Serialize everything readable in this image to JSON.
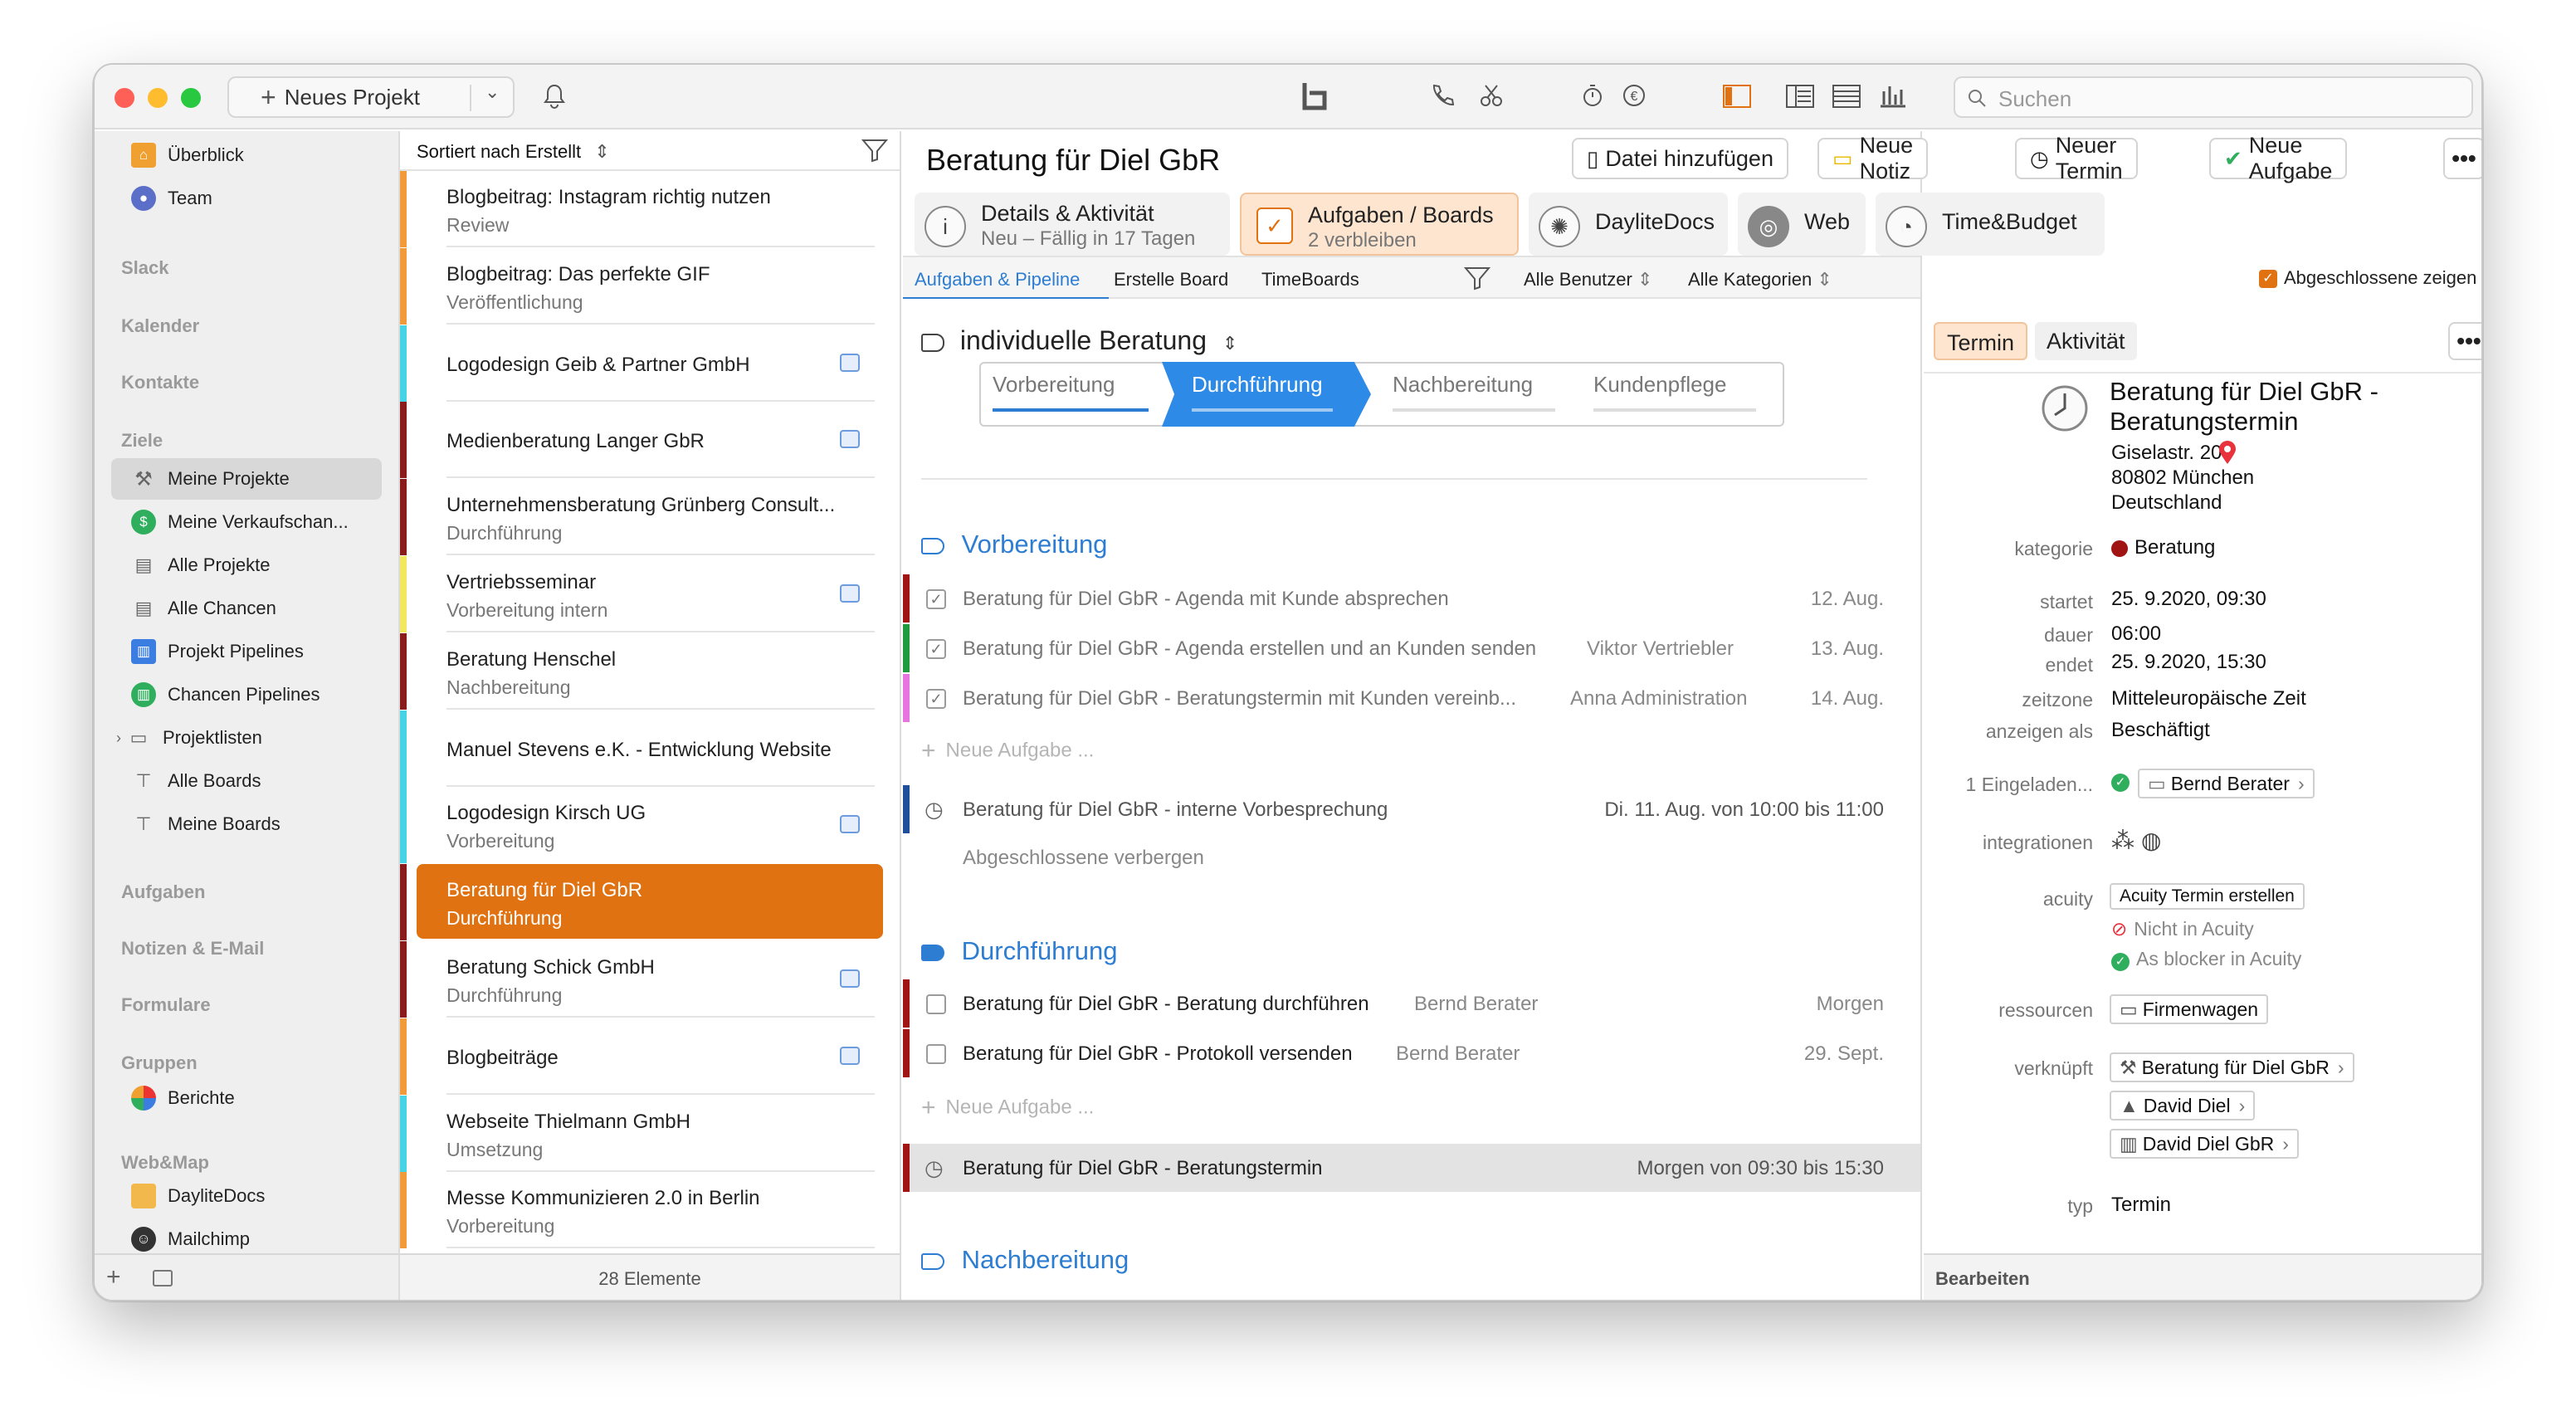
{
  "toolbar": {
    "new_project": "Neues Projekt",
    "search_placeholder": "Suchen"
  },
  "sidebar": {
    "top": [
      {
        "label": "Überblick"
      },
      {
        "label": "Team"
      }
    ],
    "sections": {
      "slack": "Slack",
      "kalender": "Kalender",
      "kontakte": "Kontakte",
      "ziele": "Ziele",
      "aufgaben": "Aufgaben",
      "notizen": "Notizen & E-Mail",
      "formulare": "Formulare",
      "gruppen": "Gruppen",
      "webmap": "Web&Map"
    },
    "ziele_items": [
      {
        "label": "Meine Projekte"
      },
      {
        "label": "Meine Verkaufschan..."
      },
      {
        "label": "Alle Projekte"
      },
      {
        "label": "Alle Chancen"
      },
      {
        "label": "Projekt Pipelines"
      },
      {
        "label": "Chancen Pipelines"
      },
      {
        "label": "Projektlisten"
      },
      {
        "label": "Alle Boards"
      },
      {
        "label": "Meine Boards"
      }
    ],
    "gruppen_items": [
      {
        "label": "Berichte"
      }
    ],
    "webmap_items": [
      {
        "label": "DayliteDocs"
      },
      {
        "label": "Mailchimp"
      }
    ]
  },
  "list": {
    "sort_label": "Sortiert nach Erstellt",
    "count": "28 Elemente",
    "items": [
      {
        "title": "Blogbeitrag: Instagram richtig nutzen",
        "sub": "Review"
      },
      {
        "title": "Blogbeitrag: Das perfekte GIF",
        "sub": "Veröffentlichung"
      },
      {
        "title": "Logodesign Geib & Partner GmbH",
        "sub": ""
      },
      {
        "title": "Medienberatung Langer GbR",
        "sub": ""
      },
      {
        "title": "Unternehmensberatung Grünberg Consult...",
        "sub": "Durchführung"
      },
      {
        "title": "Vertriebsseminar",
        "sub": "Vorbereitung intern"
      },
      {
        "title": "Beratung Henschel",
        "sub": "Nachbereitung"
      },
      {
        "title": "Manuel Stevens e.K. - Entwicklung Website",
        "sub": ""
      },
      {
        "title": "Logodesign Kirsch UG",
        "sub": "Vorbereitung"
      },
      {
        "title": "Beratung für Diel GbR",
        "sub": "Durchführung"
      },
      {
        "title": "Beratung Schick GmbH",
        "sub": "Durchführung"
      },
      {
        "title": "Blogbeiträge",
        "sub": ""
      },
      {
        "title": "Webseite Thielmann GmbH",
        "sub": "Umsetzung"
      },
      {
        "title": "Messe Kommunizieren 2.0 in Berlin",
        "sub": "Vorbereitung"
      }
    ]
  },
  "main": {
    "title": "Beratung für Diel GbR",
    "buttons": {
      "file": "Datei hinzufügen",
      "note": "Neue Notiz",
      "appointment": "Neuer Termin",
      "task": "Neue Aufgabe"
    },
    "tabs": [
      {
        "l1": "Details & Aktivität",
        "l2": "Neu – Fällig in 17 Tagen"
      },
      {
        "l1": "Aufgaben / Boards",
        "l2": "2 verbleiben"
      },
      {
        "l1": "DayliteDocs",
        "l2": ""
      },
      {
        "l1": "Web",
        "l2": ""
      },
      {
        "l1": "Time&Budget",
        "l2": ""
      }
    ],
    "filter": {
      "tab1": "Aufgaben & Pipeline",
      "tab2": "Erstelle Board",
      "tab3": "TimeBoards",
      "users": "Alle Benutzer",
      "categories": "Alle Kategorien",
      "show_done": "Abgeschlossene zeigen"
    },
    "pipeline_name": "individuelle Beratung",
    "stages": [
      "Vorbereitung",
      "Durchführung",
      "Nachbereitung",
      "Kundenpflege"
    ],
    "sections": {
      "s1": "Vorbereitung",
      "s2": "Durchführung",
      "s3": "Nachbereitung"
    },
    "new_task": "Neue Aufgabe ...",
    "hide_done": "Abgeschlossene verbergen",
    "tasks1": [
      {
        "title": "Beratung für Diel GbR - Agenda mit Kunde absprechen",
        "who": "",
        "date": "12. Aug."
      },
      {
        "title": "Beratung für Diel GbR - Agenda erstellen und an Kunden senden",
        "who": "Viktor Vertriebler",
        "date": "13. Aug."
      },
      {
        "title": "Beratung für Diel GbR - Beratungstermin mit Kunden vereinb...",
        "who": "Anna Administration",
        "date": "14. Aug."
      }
    ],
    "appt1": {
      "title": "Beratung für Diel GbR - interne Vorbesprechung",
      "date": "Di. 11. Aug. von 10:00 bis 11:00"
    },
    "tasks2": [
      {
        "title": "Beratung für Diel GbR - Beratung durchführen",
        "who": "Bernd Berater",
        "date": "Morgen"
      },
      {
        "title": "Beratung für Diel GbR - Protokoll versenden",
        "who": "Bernd Berater",
        "date": "29. Sept."
      }
    ],
    "appt2": {
      "title": "Beratung für Diel GbR - Beratungstermin",
      "date": "Morgen von 09:30 bis 15:30"
    }
  },
  "detail": {
    "tab_termin": "Termin",
    "tab_aktivitat": "Aktivität",
    "title": "Beratung für Diel GbR - Beratungstermin",
    "address1": "Giselastr. 20",
    "address2": "80802 München",
    "address3": "Deutschland",
    "labels": {
      "kategorie": "kategorie",
      "startet": "startet",
      "dauer": "dauer",
      "endet": "endet",
      "zeitzone": "zeitzone",
      "anzeigen": "anzeigen als",
      "eingeladen": "1 Eingeladen...",
      "integrationen": "integrationen",
      "acuity": "acuity",
      "ressourcen": "ressourcen",
      "verknuepft": "verknüpft",
      "typ": "typ"
    },
    "values": {
      "kategorie": "Beratung",
      "startet": "25. 9.2020, 09:30",
      "dauer": "06:00",
      "endet": "25. 9.2020, 15:30",
      "zeitzone": "Mitteleuropäische Zeit",
      "anzeigen": "Beschäftigt",
      "eingeladen": "Bernd Berater",
      "acuity_btn": "Acuity Termin erstellen",
      "acuity1": "Nicht in Acuity",
      "acuity2": "As blocker in Acuity",
      "ressourcen": "Firmenwagen",
      "link1": "Beratung für Diel GbR",
      "link2": "David Diel",
      "link3": "David Diel GbR",
      "typ": "Termin"
    },
    "footer": "Bearbeiten"
  },
  "colors": {
    "accent": "#e07212",
    "link": "#2d7dd2",
    "category_red": "#a01414"
  }
}
